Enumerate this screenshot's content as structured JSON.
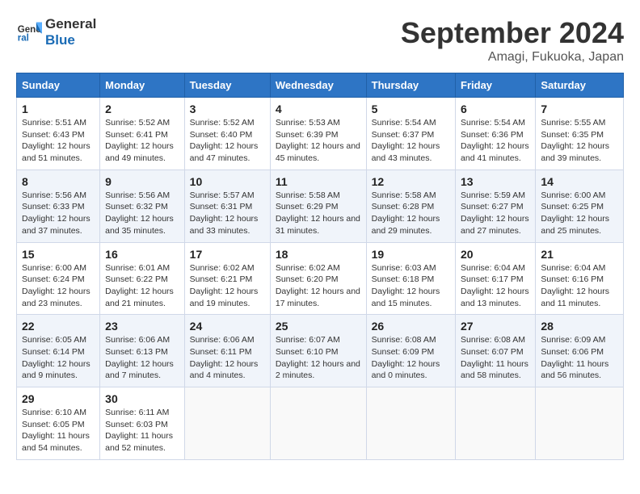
{
  "header": {
    "logo_line1": "General",
    "logo_line2": "Blue",
    "month": "September 2024",
    "location": "Amagi, Fukuoka, Japan"
  },
  "weekdays": [
    "Sunday",
    "Monday",
    "Tuesday",
    "Wednesday",
    "Thursday",
    "Friday",
    "Saturday"
  ],
  "weeks": [
    [
      {
        "day": "1",
        "sunrise": "5:51 AM",
        "sunset": "6:43 PM",
        "daylight": "12 hours and 51 minutes."
      },
      {
        "day": "2",
        "sunrise": "5:52 AM",
        "sunset": "6:41 PM",
        "daylight": "12 hours and 49 minutes."
      },
      {
        "day": "3",
        "sunrise": "5:52 AM",
        "sunset": "6:40 PM",
        "daylight": "12 hours and 47 minutes."
      },
      {
        "day": "4",
        "sunrise": "5:53 AM",
        "sunset": "6:39 PM",
        "daylight": "12 hours and 45 minutes."
      },
      {
        "day": "5",
        "sunrise": "5:54 AM",
        "sunset": "6:37 PM",
        "daylight": "12 hours and 43 minutes."
      },
      {
        "day": "6",
        "sunrise": "5:54 AM",
        "sunset": "6:36 PM",
        "daylight": "12 hours and 41 minutes."
      },
      {
        "day": "7",
        "sunrise": "5:55 AM",
        "sunset": "6:35 PM",
        "daylight": "12 hours and 39 minutes."
      }
    ],
    [
      {
        "day": "8",
        "sunrise": "5:56 AM",
        "sunset": "6:33 PM",
        "daylight": "12 hours and 37 minutes."
      },
      {
        "day": "9",
        "sunrise": "5:56 AM",
        "sunset": "6:32 PM",
        "daylight": "12 hours and 35 minutes."
      },
      {
        "day": "10",
        "sunrise": "5:57 AM",
        "sunset": "6:31 PM",
        "daylight": "12 hours and 33 minutes."
      },
      {
        "day": "11",
        "sunrise": "5:58 AM",
        "sunset": "6:29 PM",
        "daylight": "12 hours and 31 minutes."
      },
      {
        "day": "12",
        "sunrise": "5:58 AM",
        "sunset": "6:28 PM",
        "daylight": "12 hours and 29 minutes."
      },
      {
        "day": "13",
        "sunrise": "5:59 AM",
        "sunset": "6:27 PM",
        "daylight": "12 hours and 27 minutes."
      },
      {
        "day": "14",
        "sunrise": "6:00 AM",
        "sunset": "6:25 PM",
        "daylight": "12 hours and 25 minutes."
      }
    ],
    [
      {
        "day": "15",
        "sunrise": "6:00 AM",
        "sunset": "6:24 PM",
        "daylight": "12 hours and 23 minutes."
      },
      {
        "day": "16",
        "sunrise": "6:01 AM",
        "sunset": "6:22 PM",
        "daylight": "12 hours and 21 minutes."
      },
      {
        "day": "17",
        "sunrise": "6:02 AM",
        "sunset": "6:21 PM",
        "daylight": "12 hours and 19 minutes."
      },
      {
        "day": "18",
        "sunrise": "6:02 AM",
        "sunset": "6:20 PM",
        "daylight": "12 hours and 17 minutes."
      },
      {
        "day": "19",
        "sunrise": "6:03 AM",
        "sunset": "6:18 PM",
        "daylight": "12 hours and 15 minutes."
      },
      {
        "day": "20",
        "sunrise": "6:04 AM",
        "sunset": "6:17 PM",
        "daylight": "12 hours and 13 minutes."
      },
      {
        "day": "21",
        "sunrise": "6:04 AM",
        "sunset": "6:16 PM",
        "daylight": "12 hours and 11 minutes."
      }
    ],
    [
      {
        "day": "22",
        "sunrise": "6:05 AM",
        "sunset": "6:14 PM",
        "daylight": "12 hours and 9 minutes."
      },
      {
        "day": "23",
        "sunrise": "6:06 AM",
        "sunset": "6:13 PM",
        "daylight": "12 hours and 7 minutes."
      },
      {
        "day": "24",
        "sunrise": "6:06 AM",
        "sunset": "6:11 PM",
        "daylight": "12 hours and 4 minutes."
      },
      {
        "day": "25",
        "sunrise": "6:07 AM",
        "sunset": "6:10 PM",
        "daylight": "12 hours and 2 minutes."
      },
      {
        "day": "26",
        "sunrise": "6:08 AM",
        "sunset": "6:09 PM",
        "daylight": "12 hours and 0 minutes."
      },
      {
        "day": "27",
        "sunrise": "6:08 AM",
        "sunset": "6:07 PM",
        "daylight": "11 hours and 58 minutes."
      },
      {
        "day": "28",
        "sunrise": "6:09 AM",
        "sunset": "6:06 PM",
        "daylight": "11 hours and 56 minutes."
      }
    ],
    [
      {
        "day": "29",
        "sunrise": "6:10 AM",
        "sunset": "6:05 PM",
        "daylight": "11 hours and 54 minutes."
      },
      {
        "day": "30",
        "sunrise": "6:11 AM",
        "sunset": "6:03 PM",
        "daylight": "11 hours and 52 minutes."
      },
      null,
      null,
      null,
      null,
      null
    ]
  ]
}
